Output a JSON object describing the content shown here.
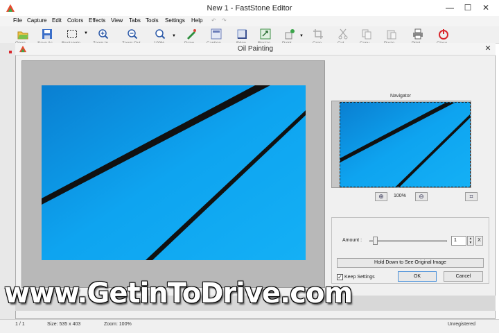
{
  "window": {
    "title": "New 1 - FastStone Editor",
    "controls": {
      "minimize": "—",
      "maximize": "☐",
      "close": "✕"
    }
  },
  "menu": {
    "items": [
      "File",
      "Capture",
      "Edit",
      "Colors",
      "Effects",
      "View",
      "Tabs",
      "Tools",
      "Settings",
      "Help"
    ]
  },
  "toolbar": {
    "items": [
      {
        "icon": "open-icon",
        "label": "Open"
      },
      {
        "icon": "save-icon",
        "label": "Save As"
      },
      {
        "icon": "rectangle-select-icon",
        "label": "Rectangle"
      },
      {
        "icon": "zoom-in-icon",
        "label": "Zoom In"
      },
      {
        "icon": "zoom-out-icon",
        "label": "Zoom Out"
      },
      {
        "icon": "zoom-level-icon",
        "label": "100%"
      },
      {
        "icon": "draw-icon",
        "label": "Draw"
      },
      {
        "icon": "caption-icon",
        "label": "Caption"
      },
      {
        "icon": "edge-icon",
        "label": "Edge"
      },
      {
        "icon": "resize-icon",
        "label": "Resize"
      },
      {
        "icon": "paint-icon",
        "label": "Paint"
      },
      {
        "icon": "crop-icon",
        "label": "Crop"
      },
      {
        "icon": "cut-icon",
        "label": "Cut"
      },
      {
        "icon": "copy-icon",
        "label": "Copy"
      },
      {
        "icon": "paste-icon",
        "label": "Paste"
      },
      {
        "icon": "print-icon",
        "label": "Print"
      },
      {
        "icon": "close-icon",
        "label": "Close"
      }
    ]
  },
  "dialog": {
    "title": "Oil Painting",
    "close": "✕",
    "navigator": {
      "label": "Navigator",
      "zoom_text": "100%"
    },
    "amount": {
      "label": "Amount :",
      "value": "1",
      "reset": "X",
      "slider_fraction": 0.05
    },
    "hold_button": "Hold Down to See Original Image",
    "keep_settings": {
      "label": "Keep Settings",
      "checked": true
    },
    "ok": "OK",
    "cancel": "Cancel"
  },
  "status": {
    "page": "1 / 1",
    "size": "Size: 535 x 403",
    "zoom": "Zoom: 100%",
    "registration": "Unregistered"
  },
  "watermark": "www.GetinToDrive.com",
  "colors": {
    "image_blue": "#0ea4f0",
    "stripe": "#111111"
  }
}
